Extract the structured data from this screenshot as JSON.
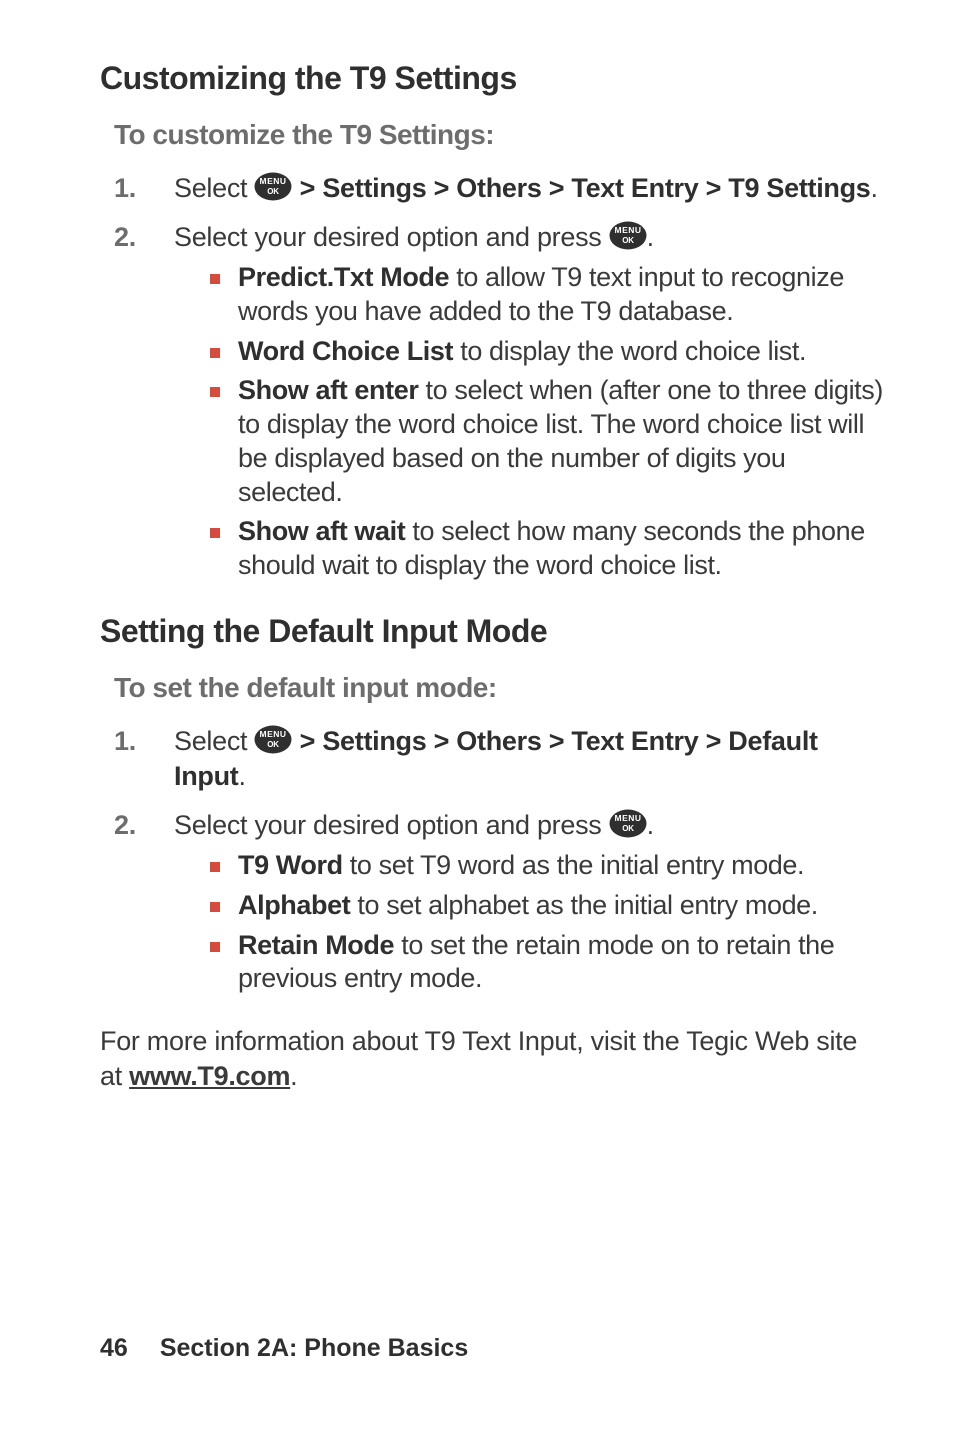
{
  "section1": {
    "title": "Customizing the T9 Settings",
    "subtitle": "To customize the T9 Settings:",
    "step1": {
      "num": "1.",
      "pre": "Select ",
      "path": " > Settings > Others > Text Entry > T9 Settings",
      "post": "."
    },
    "step2": {
      "num": "2.",
      "pre": "Select your desired option and press ",
      "post": ".",
      "bullets": [
        {
          "b": "Predict.Txt Mode",
          "t": " to allow T9 text input to recognize words you have added to the T9 database."
        },
        {
          "b": "Word Choice List",
          "t": " to display the word choice list."
        },
        {
          "b": "Show aft enter",
          "t": " to select when (after one to three digits) to display the word choice list. The word choice list will be displayed based on the number of digits you selected."
        },
        {
          "b": "Show aft wait",
          "t": " to select how many seconds the phone should wait to display the word choice list."
        }
      ]
    }
  },
  "section2": {
    "title": "Setting the Default Input Mode",
    "subtitle": "To set the default input mode:",
    "step1": {
      "num": "1.",
      "pre": "Select ",
      "path": " > Settings > Others > Text Entry > Default Input",
      "post": "."
    },
    "step2": {
      "num": "2.",
      "pre": "Select your desired option and press ",
      "post": ".",
      "bullets": [
        {
          "b": "T9 Word",
          "t": " to set T9 word as the initial entry mode."
        },
        {
          "b": "Alphabet",
          "t": " to set alphabet as the initial entry mode."
        },
        {
          "b": "Retain Mode",
          "t": " to set the retain mode on to retain the previous entry mode."
        }
      ]
    },
    "para": {
      "pre": "For more information about T9 Text Input, visit the Tegic Web site at ",
      "link": "www.T9.com",
      "post": "."
    }
  },
  "footer": {
    "page": "46",
    "section": "Section 2A: Phone Basics"
  }
}
